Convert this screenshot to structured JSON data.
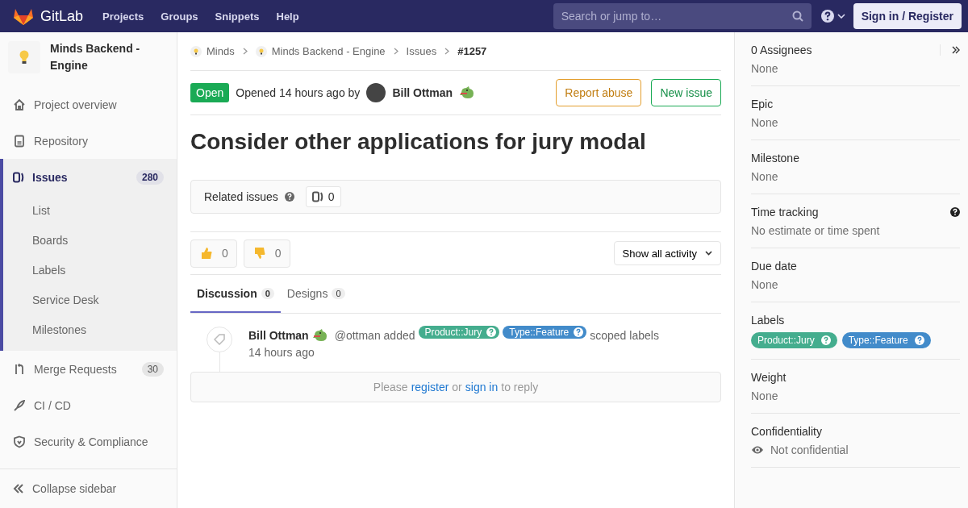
{
  "topbar": {
    "logo": "GitLab",
    "nav": [
      "Projects",
      "Groups",
      "Snippets",
      "Help"
    ],
    "search": {
      "placeholder": "Search or jump to…"
    },
    "sign_in": "Sign in / Register"
  },
  "sidebar": {
    "project": "Minds Backend - Engine",
    "items": [
      {
        "label": "Project overview",
        "selected": false
      },
      {
        "label": "Repository",
        "selected": false
      },
      {
        "label": "Issues",
        "count": "280",
        "selected": true,
        "children": [
          {
            "label": "List"
          },
          {
            "label": "Boards"
          },
          {
            "label": "Labels"
          },
          {
            "label": "Service Desk"
          },
          {
            "label": "Milestones"
          }
        ]
      },
      {
        "label": "Merge Requests",
        "count": "30",
        "selected": false
      },
      {
        "label": "CI / CD",
        "selected": false
      },
      {
        "label": "Security & Compliance",
        "selected": false
      }
    ],
    "collapse": "Collapse sidebar"
  },
  "breadcrumb": [
    "Minds",
    "Minds Backend - Engine",
    "Issues",
    "#1257"
  ],
  "issue": {
    "status": "Open",
    "opened": "Opened 14 hours ago by",
    "author": "Bill Ottman",
    "buttons": [
      "Report abuse",
      "New issue"
    ],
    "title": "Consider other applications for jury modal",
    "related": {
      "label": "Related issues",
      "count": "0"
    },
    "awards": [
      "0",
      "0"
    ],
    "filter": "Show all activity",
    "tabs": [
      {
        "label": "Discussion",
        "count": "0",
        "selected": true
      },
      {
        "label": "Designs",
        "count": "0",
        "selected": false
      }
    ],
    "note": {
      "author": "Bill Ottman",
      "action": "@ottman added",
      "labels": [
        {
          "text": "Product::Jury",
          "color": "#44ad8e"
        },
        {
          "text": "Type::Feature",
          "color": "#428bca"
        }
      ],
      "suffix": "scoped labels",
      "time": "14 hours ago"
    },
    "reply": [
      {
        "kind": "text",
        "text": "Please"
      },
      {
        "kind": "link",
        "text": "register"
      },
      {
        "kind": "text",
        "text": "or"
      },
      {
        "kind": "link",
        "text": "sign in"
      },
      {
        "kind": "text",
        "text": "to reply"
      }
    ]
  },
  "right": [
    {
      "kind": "text",
      "title": "0 Assignees",
      "value": "None"
    },
    {
      "kind": "text",
      "title": "Epic",
      "value": "None"
    },
    {
      "kind": "text",
      "title": "Milestone",
      "value": "None"
    },
    {
      "kind": "help",
      "title": "Time tracking",
      "value": "No estimate or time spent"
    },
    {
      "kind": "text",
      "title": "Due date",
      "value": "None"
    },
    {
      "kind": "labels",
      "title": "Labels",
      "labels": [
        {
          "text": "Product::Jury",
          "color": "#44ad8e"
        },
        {
          "text": "Type::Feature",
          "color": "#428bca"
        }
      ]
    },
    {
      "kind": "text",
      "title": "Weight",
      "value": "None"
    },
    {
      "kind": "eye",
      "title": "Confidentiality",
      "value": "Not confidential"
    }
  ]
}
